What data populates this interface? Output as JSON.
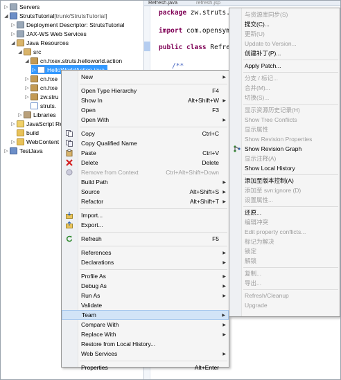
{
  "editor": {
    "tabs": [
      "Refresh.java",
      "refresh.jsp"
    ],
    "code": {
      "line1_kw": "package",
      "line1_rest": " zw.struts.r",
      "line2_kw": "import",
      "line2_rest": " com.opensymp",
      "line3_kw": "public class",
      "line3_rest": " Refre",
      "line4": "/**"
    }
  },
  "explorer": {
    "rows": [
      {
        "label": "Servers",
        "icon": "server-folder-icon"
      },
      {
        "label": "StrutsTutorial",
        "suffix": " [trunk/StrutsTutorial]",
        "icon": "project-icon"
      },
      {
        "label": "Deployment Descriptor: StrutsTutorial",
        "icon": "descriptor-icon"
      },
      {
        "label": "JAX-WS Web Services",
        "icon": "webservice-icon"
      },
      {
        "label": "Java Resources",
        "icon": "java-resources-icon"
      },
      {
        "label": "src",
        "icon": "source-folder-icon"
      },
      {
        "label": "cn.hxex.struts.helloworld.action",
        "icon": "package-icon"
      },
      {
        "label": "HelloWorldAction.java",
        "icon": "java-file-icon"
      },
      {
        "label": "cn.hxe",
        "icon": "package-icon"
      },
      {
        "label": "cn.hxe",
        "icon": "package-icon"
      },
      {
        "label": "zw.stru",
        "icon": "package-icon"
      },
      {
        "label": "struts.",
        "icon": "xml-file-icon"
      },
      {
        "label": "Libraries",
        "icon": "libraries-icon"
      },
      {
        "label": "JavaScript Re",
        "icon": "javascript-icon"
      },
      {
        "label": "build",
        "icon": "folder-icon"
      },
      {
        "label": "WebContent",
        "icon": "folder-icon"
      },
      {
        "label": "TestJava",
        "icon": "project-icon"
      }
    ]
  },
  "context_menu": {
    "items": [
      {
        "label": "New",
        "shortcut": "",
        "submenu": true,
        "disabled": false
      },
      {
        "sep": true
      },
      {
        "label": "Open Type Hierarchy",
        "shortcut": "F4",
        "submenu": false,
        "disabled": false
      },
      {
        "label": "Show In",
        "shortcut": "Alt+Shift+W",
        "submenu": true,
        "disabled": false
      },
      {
        "label": "Open",
        "shortcut": "F3",
        "submenu": false,
        "disabled": false
      },
      {
        "label": "Open With",
        "shortcut": "",
        "submenu": true,
        "disabled": false
      },
      {
        "sep": true
      },
      {
        "label": "Copy",
        "shortcut": "Ctrl+C",
        "submenu": false,
        "disabled": false,
        "icon": "copy-icon"
      },
      {
        "label": "Copy Qualified Name",
        "shortcut": "",
        "submenu": false,
        "disabled": false,
        "icon": "copy-qualified-icon"
      },
      {
        "label": "Paste",
        "shortcut": "Ctrl+V",
        "submenu": false,
        "disabled": false,
        "icon": "paste-icon"
      },
      {
        "label": "Delete",
        "shortcut": "Delete",
        "submenu": false,
        "disabled": false,
        "icon": "delete-icon"
      },
      {
        "label": "Remove from Context",
        "shortcut": "Ctrl+Alt+Shift+Down",
        "submenu": false,
        "disabled": true,
        "icon": "remove-context-icon"
      },
      {
        "label": "Build Path",
        "shortcut": "",
        "submenu": true,
        "disabled": false
      },
      {
        "label": "Source",
        "shortcut": "Alt+Shift+S",
        "submenu": true,
        "disabled": false
      },
      {
        "label": "Refactor",
        "shortcut": "Alt+Shift+T",
        "submenu": true,
        "disabled": false
      },
      {
        "sep": true
      },
      {
        "label": "Import...",
        "shortcut": "",
        "submenu": false,
        "disabled": false,
        "icon": "import-icon"
      },
      {
        "label": "Export...",
        "shortcut": "",
        "submenu": false,
        "disabled": false,
        "icon": "export-icon"
      },
      {
        "sep": true
      },
      {
        "label": "Refresh",
        "shortcut": "F5",
        "submenu": false,
        "disabled": false,
        "icon": "refresh-icon"
      },
      {
        "sep": true
      },
      {
        "label": "References",
        "shortcut": "",
        "submenu": true,
        "disabled": false
      },
      {
        "label": "Declarations",
        "shortcut": "",
        "submenu": true,
        "disabled": false
      },
      {
        "sep": true
      },
      {
        "label": "Profile As",
        "shortcut": "",
        "submenu": true,
        "disabled": false
      },
      {
        "label": "Debug As",
        "shortcut": "",
        "submenu": true,
        "disabled": false
      },
      {
        "label": "Run As",
        "shortcut": "",
        "submenu": true,
        "disabled": false
      },
      {
        "label": "Validate",
        "shortcut": "",
        "submenu": false,
        "disabled": false
      },
      {
        "label": "Team",
        "shortcut": "",
        "submenu": true,
        "disabled": false,
        "highlighted": true
      },
      {
        "label": "Compare With",
        "shortcut": "",
        "submenu": true,
        "disabled": false
      },
      {
        "label": "Replace With",
        "shortcut": "",
        "submenu": true,
        "disabled": false
      },
      {
        "label": "Restore from Local History...",
        "shortcut": "",
        "submenu": false,
        "disabled": false
      },
      {
        "label": "Web Services",
        "shortcut": "",
        "submenu": true,
        "disabled": false
      },
      {
        "sep": true
      },
      {
        "label": "Properties",
        "shortcut": "Alt+Enter",
        "submenu": false,
        "disabled": false
      }
    ]
  },
  "team_submenu": {
    "items": [
      {
        "label": "与资源库同步(S)",
        "disabled": true
      },
      {
        "label": "提交(C)...",
        "disabled": false
      },
      {
        "label": "更新(U)",
        "disabled": true
      },
      {
        "label": "Update to Version...",
        "disabled": true
      },
      {
        "label": "创建补丁(P)...",
        "disabled": false
      },
      {
        "sep": true
      },
      {
        "label": "Apply Patch...",
        "disabled": false
      },
      {
        "sep": true
      },
      {
        "label": "分支 / 标记...",
        "disabled": true
      },
      {
        "label": "合并(M)...",
        "disabled": true
      },
      {
        "label": "切换(S)...",
        "disabled": true
      },
      {
        "sep": true
      },
      {
        "label": "显示资源历史记录(H)",
        "disabled": true
      },
      {
        "label": "Show Tree Conflicts",
        "disabled": true
      },
      {
        "label": "显示属性",
        "disabled": true
      },
      {
        "label": "Show Revision Properties",
        "disabled": true
      },
      {
        "label": "Show Revision Graph",
        "disabled": false,
        "icon": "revision-graph-icon"
      },
      {
        "label": "显示注释(A)",
        "disabled": true
      },
      {
        "label": "Show Local History",
        "disabled": false
      },
      {
        "sep": true
      },
      {
        "label": "添加至版本控制(A)",
        "disabled": false
      },
      {
        "label": "添加至 svn:ignore (D)",
        "disabled": true
      },
      {
        "label": "设置属性...",
        "disabled": true
      },
      {
        "sep": true
      },
      {
        "label": "还原...",
        "disabled": false
      },
      {
        "label": "编辑冲突",
        "disabled": true
      },
      {
        "label": "Edit property conflicts...",
        "disabled": true
      },
      {
        "label": "标记为解决",
        "disabled": true
      },
      {
        "label": "锁定",
        "disabled": true
      },
      {
        "label": "解锁",
        "disabled": true
      },
      {
        "sep": true
      },
      {
        "label": "复制...",
        "disabled": true
      },
      {
        "label": "导出...",
        "disabled": true
      },
      {
        "sep": true
      },
      {
        "label": "Refresh/Cleanup",
        "disabled": true
      },
      {
        "label": "Upgrade",
        "disabled": true
      }
    ]
  }
}
